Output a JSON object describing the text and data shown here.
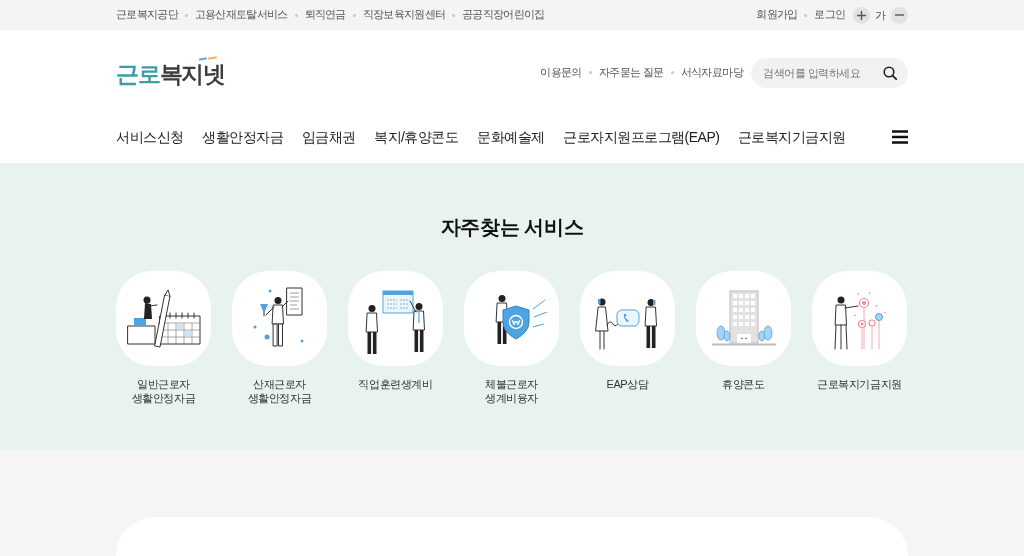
{
  "top_bar": {
    "links": [
      "근로복지공단",
      "고용산재토탈서비스",
      "퇴직연금",
      "직장보육지원센터",
      "공공직장어린이집"
    ],
    "account_links": [
      "회원가입",
      "로그인"
    ],
    "font_size_label": "가"
  },
  "header": {
    "logo": {
      "lead": "근로",
      "tail": "복지넷"
    },
    "utility_links": [
      "이용문의",
      "자주묻는 질문",
      "서식자료마당"
    ],
    "search": {
      "placeholder": "검색어를 입력하세요"
    }
  },
  "nav": {
    "items": [
      "서비스신청",
      "생활안정자금",
      "임금채권",
      "복지/휴양콘도",
      "문화예술제",
      "근로자지원프로그램(EAP)",
      "근로복지기금지원"
    ]
  },
  "frequent_services": {
    "title": "자주찾는 서비스",
    "items": [
      {
        "kind": "calendar",
        "label_lines": [
          "일반근로자",
          "생활안정자금"
        ]
      },
      {
        "kind": "document",
        "label_lines": [
          "산재근로자",
          "생활안정자금"
        ]
      },
      {
        "kind": "training",
        "label_lines": [
          "직업훈련생계비"
        ]
      },
      {
        "kind": "shield",
        "label_lines": [
          "체불근로자",
          "생계비융자"
        ]
      },
      {
        "kind": "phone",
        "label_lines": [
          "EAP상담"
        ]
      },
      {
        "kind": "building",
        "label_lines": [
          "휴양콘도"
        ]
      },
      {
        "kind": "flowers",
        "label_lines": [
          "근로복지기금지원"
        ]
      }
    ]
  }
}
